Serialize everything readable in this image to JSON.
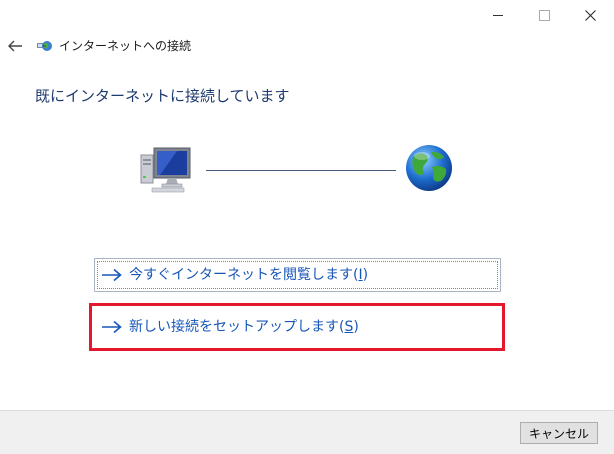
{
  "window": {
    "title": "インターネットへの接続"
  },
  "main": {
    "heading": "既にインターネットに接続しています",
    "options": [
      {
        "label": "今すぐインターネットを閲覧します(",
        "accesskey": "I",
        "tail": ")"
      },
      {
        "label": "新しい接続をセットアップします(",
        "accesskey": "S",
        "tail": ")"
      }
    ]
  },
  "footer": {
    "cancel_label": "キャンセル"
  },
  "colors": {
    "link": "#1856b8",
    "heading": "#1e3a6e",
    "highlight": "#e3182d"
  }
}
